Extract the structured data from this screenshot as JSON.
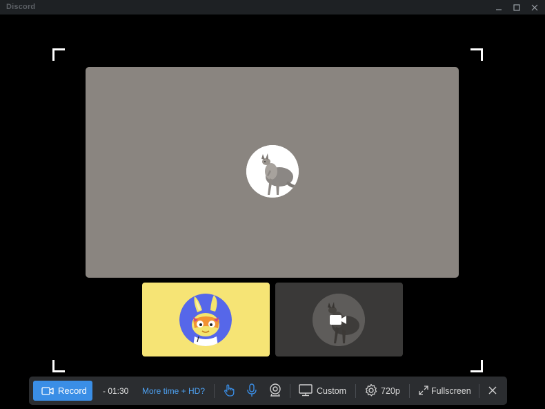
{
  "window": {
    "title": "Discord"
  },
  "toolbar": {
    "record_label": "Record",
    "timer": "- 01:30",
    "upgrade_link": "More time + HD?",
    "area_label": "Custom",
    "quality_label": "720p",
    "fullscreen_label": "Fullscreen"
  },
  "colors": {
    "accent": "#3a8ee6",
    "link": "#4ea3f5",
    "main_tile": "#8a8580",
    "tile_yellow": "#f6e475",
    "tile_dark": "#3a3938",
    "toolbar_bg": "#2b2d30"
  },
  "icons": {
    "record": "video-camera-icon",
    "pointer": "hand-pointer-icon",
    "microphone": "microphone-icon",
    "webcam": "webcam-icon",
    "screen": "monitor-icon",
    "settings": "gear-icon",
    "fullscreen": "expand-arrows-icon",
    "close": "close-icon",
    "camera_off_overlay": "video-camera-icon"
  }
}
